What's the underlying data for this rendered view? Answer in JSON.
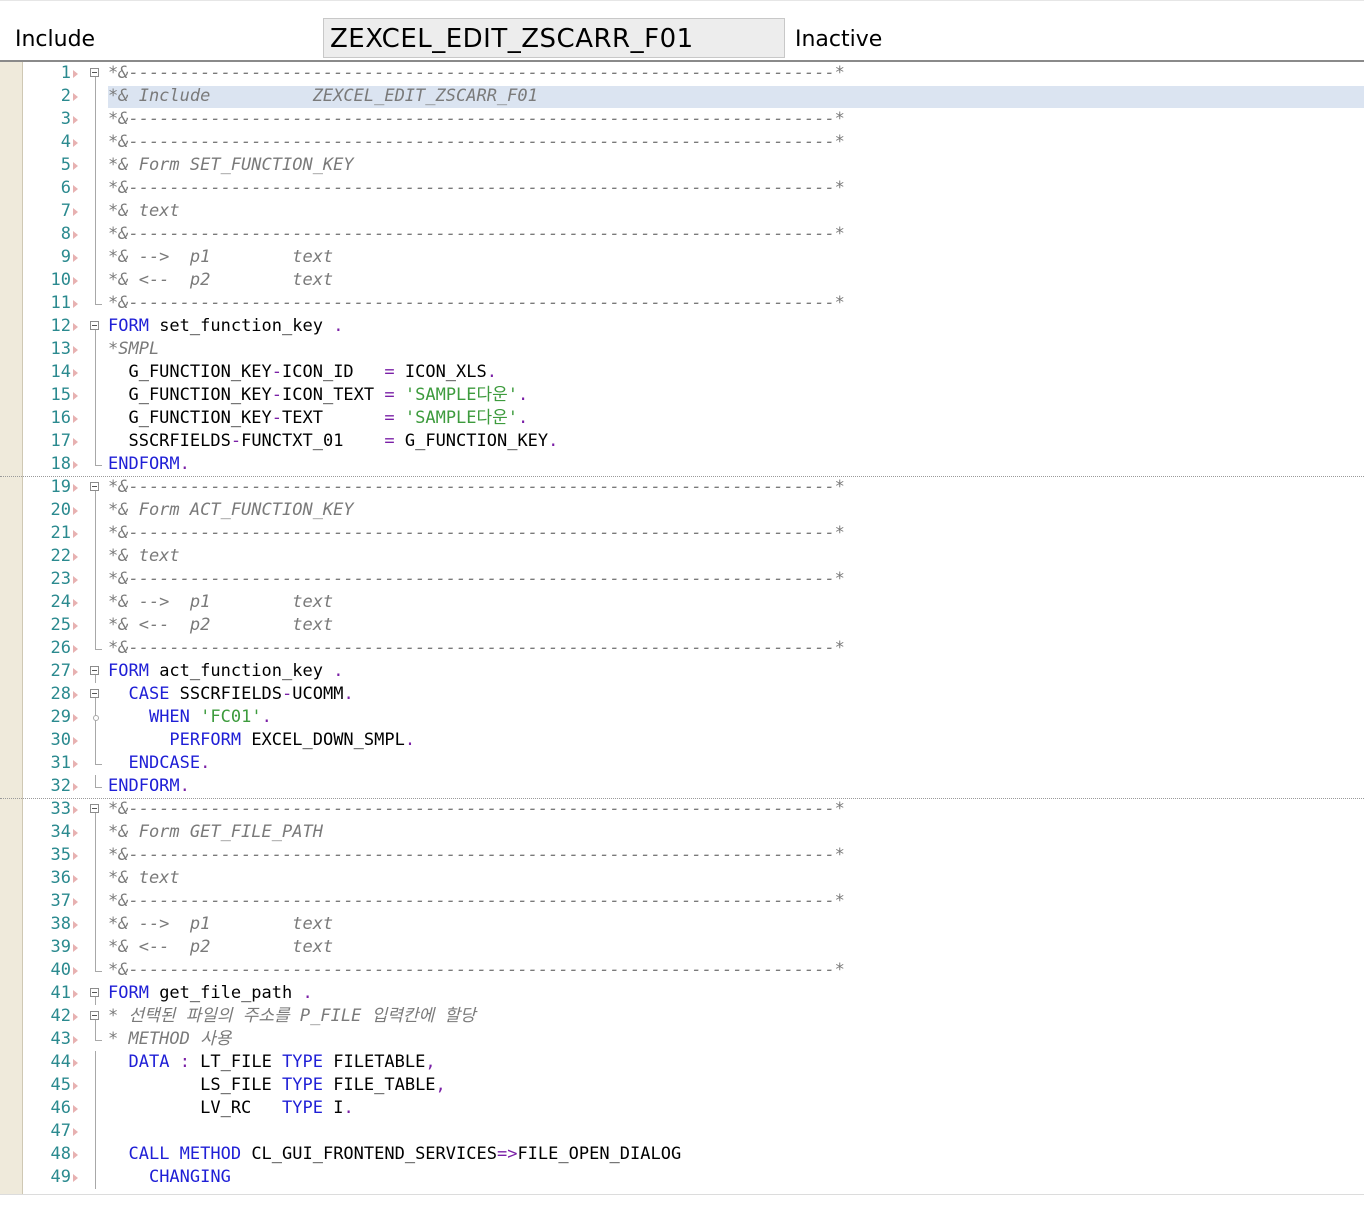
{
  "header": {
    "label": "Include",
    "include_name": "ZEXCEL_EDIT_ZSCARR_F01",
    "status": "Inactive"
  },
  "colors": {
    "keyword": "#1f1fd6",
    "string": "#3d9b3d",
    "comment": "#7a7a7a",
    "line_number": "#2b8a8f",
    "highlight": "#dbe4f1"
  },
  "editor": {
    "lines": [
      {
        "n": "1",
        "fold": "box",
        "type": "comment",
        "segments": [
          {
            "t": "*&---------------------------------------------------------------------*"
          }
        ]
      },
      {
        "n": "2",
        "fold": "line",
        "type": "comment",
        "highlight": true,
        "segments": [
          {
            "t": "*& Include          ZEXCEL_EDIT_ZSCARR_F01"
          }
        ]
      },
      {
        "n": "3",
        "fold": "line",
        "type": "comment",
        "segments": [
          {
            "t": "*&---------------------------------------------------------------------*"
          }
        ]
      },
      {
        "n": "4",
        "fold": "line",
        "type": "comment",
        "segments": [
          {
            "t": "*&---------------------------------------------------------------------*"
          }
        ]
      },
      {
        "n": "5",
        "fold": "line",
        "type": "comment",
        "segments": [
          {
            "t": "*& Form SET_FUNCTION_KEY"
          }
        ]
      },
      {
        "n": "6",
        "fold": "line",
        "type": "comment",
        "segments": [
          {
            "t": "*&---------------------------------------------------------------------*"
          }
        ]
      },
      {
        "n": "7",
        "fold": "line",
        "type": "comment",
        "segments": [
          {
            "t": "*& text"
          }
        ]
      },
      {
        "n": "8",
        "fold": "line",
        "type": "comment",
        "segments": [
          {
            "t": "*&---------------------------------------------------------------------*"
          }
        ]
      },
      {
        "n": "9",
        "fold": "line",
        "type": "comment",
        "segments": [
          {
            "t": "*& -->  p1        text"
          }
        ]
      },
      {
        "n": "10",
        "fold": "line",
        "type": "comment",
        "segments": [
          {
            "t": "*& <--  p2        text"
          }
        ]
      },
      {
        "n": "11",
        "fold": "end",
        "type": "comment",
        "segments": [
          {
            "t": "*&---------------------------------------------------------------------*"
          }
        ]
      },
      {
        "n": "12",
        "fold": "box",
        "type": "code",
        "segments": [
          {
            "t": "FORM",
            "c": "k"
          },
          {
            "t": " set_function_key "
          },
          {
            "t": ".",
            "c": "p"
          }
        ]
      },
      {
        "n": "13",
        "fold": "line",
        "type": "comment",
        "segments": [
          {
            "t": "*SMPL"
          }
        ]
      },
      {
        "n": "14",
        "fold": "line",
        "type": "code",
        "segments": [
          {
            "t": "  G_FUNCTION_KEY"
          },
          {
            "t": "-",
            "c": "p"
          },
          {
            "t": "ICON_ID   "
          },
          {
            "t": "=",
            "c": "p"
          },
          {
            "t": " ICON_XLS"
          },
          {
            "t": ".",
            "c": "p"
          }
        ]
      },
      {
        "n": "15",
        "fold": "line",
        "type": "code",
        "segments": [
          {
            "t": "  G_FUNCTION_KEY"
          },
          {
            "t": "-",
            "c": "p"
          },
          {
            "t": "ICON_TEXT "
          },
          {
            "t": "=",
            "c": "p"
          },
          {
            "t": " "
          },
          {
            "t": "'SAMPLE다운'",
            "c": "s"
          },
          {
            "t": ".",
            "c": "p"
          }
        ]
      },
      {
        "n": "16",
        "fold": "line",
        "type": "code",
        "segments": [
          {
            "t": "  G_FUNCTION_KEY"
          },
          {
            "t": "-",
            "c": "p"
          },
          {
            "t": "TEXT      "
          },
          {
            "t": "=",
            "c": "p"
          },
          {
            "t": " "
          },
          {
            "t": "'SAMPLE다운'",
            "c": "s"
          },
          {
            "t": ".",
            "c": "p"
          }
        ]
      },
      {
        "n": "17",
        "fold": "line",
        "type": "code",
        "segments": [
          {
            "t": "  SSCRFIELDS"
          },
          {
            "t": "-",
            "c": "p"
          },
          {
            "t": "FUNCTXT_01    "
          },
          {
            "t": "=",
            "c": "p"
          },
          {
            "t": " G_FUNCTION_KEY"
          },
          {
            "t": ".",
            "c": "p"
          }
        ]
      },
      {
        "n": "18",
        "fold": "end",
        "type": "code",
        "sep": true,
        "segments": [
          {
            "t": "ENDFORM",
            "c": "k"
          },
          {
            "t": ".",
            "c": "p"
          }
        ]
      },
      {
        "n": "19",
        "fold": "box",
        "type": "comment",
        "segments": [
          {
            "t": "*&---------------------------------------------------------------------*"
          }
        ]
      },
      {
        "n": "20",
        "fold": "line",
        "type": "comment",
        "segments": [
          {
            "t": "*& Form ACT_FUNCTION_KEY"
          }
        ]
      },
      {
        "n": "21",
        "fold": "line",
        "type": "comment",
        "segments": [
          {
            "t": "*&---------------------------------------------------------------------*"
          }
        ]
      },
      {
        "n": "22",
        "fold": "line",
        "type": "comment",
        "segments": [
          {
            "t": "*& text"
          }
        ]
      },
      {
        "n": "23",
        "fold": "line",
        "type": "comment",
        "segments": [
          {
            "t": "*&---------------------------------------------------------------------*"
          }
        ]
      },
      {
        "n": "24",
        "fold": "line",
        "type": "comment",
        "segments": [
          {
            "t": "*& -->  p1        text"
          }
        ]
      },
      {
        "n": "25",
        "fold": "line",
        "type": "comment",
        "segments": [
          {
            "t": "*& <--  p2        text"
          }
        ]
      },
      {
        "n": "26",
        "fold": "end",
        "type": "comment",
        "segments": [
          {
            "t": "*&---------------------------------------------------------------------*"
          }
        ]
      },
      {
        "n": "27",
        "fold": "box",
        "type": "code",
        "segments": [
          {
            "t": "FORM",
            "c": "k"
          },
          {
            "t": " act_function_key "
          },
          {
            "t": ".",
            "c": "p"
          }
        ]
      },
      {
        "n": "28",
        "fold": "box",
        "type": "code",
        "segments": [
          {
            "t": "  "
          },
          {
            "t": "CASE",
            "c": "k"
          },
          {
            "t": " SSCRFIELDS"
          },
          {
            "t": "-",
            "c": "p"
          },
          {
            "t": "UCOMM"
          },
          {
            "t": ".",
            "c": "p"
          }
        ]
      },
      {
        "n": "29",
        "fold": "dot",
        "type": "code",
        "segments": [
          {
            "t": "    "
          },
          {
            "t": "WHEN",
            "c": "k"
          },
          {
            "t": " "
          },
          {
            "t": "'FC01'",
            "c": "s"
          },
          {
            "t": ".",
            "c": "p"
          }
        ]
      },
      {
        "n": "30",
        "fold": "line",
        "type": "code",
        "segments": [
          {
            "t": "      "
          },
          {
            "t": "PERFORM",
            "c": "k"
          },
          {
            "t": " EXCEL_DOWN_SMPL"
          },
          {
            "t": ".",
            "c": "p"
          }
        ]
      },
      {
        "n": "31",
        "fold": "end",
        "type": "code",
        "segments": [
          {
            "t": "  "
          },
          {
            "t": "ENDCASE",
            "c": "k"
          },
          {
            "t": ".",
            "c": "p"
          }
        ]
      },
      {
        "n": "32",
        "fold": "end",
        "type": "code",
        "sep": true,
        "segments": [
          {
            "t": "ENDFORM",
            "c": "k"
          },
          {
            "t": ".",
            "c": "p"
          }
        ]
      },
      {
        "n": "33",
        "fold": "box",
        "type": "comment",
        "segments": [
          {
            "t": "*&---------------------------------------------------------------------*"
          }
        ]
      },
      {
        "n": "34",
        "fold": "line",
        "type": "comment",
        "segments": [
          {
            "t": "*& Form GET_FILE_PATH"
          }
        ]
      },
      {
        "n": "35",
        "fold": "line",
        "type": "comment",
        "segments": [
          {
            "t": "*&---------------------------------------------------------------------*"
          }
        ]
      },
      {
        "n": "36",
        "fold": "line",
        "type": "comment",
        "segments": [
          {
            "t": "*& text"
          }
        ]
      },
      {
        "n": "37",
        "fold": "line",
        "type": "comment",
        "segments": [
          {
            "t": "*&---------------------------------------------------------------------*"
          }
        ]
      },
      {
        "n": "38",
        "fold": "line",
        "type": "comment",
        "segments": [
          {
            "t": "*& -->  p1        text"
          }
        ]
      },
      {
        "n": "39",
        "fold": "line",
        "type": "comment",
        "segments": [
          {
            "t": "*& <--  p2        text"
          }
        ]
      },
      {
        "n": "40",
        "fold": "end",
        "type": "comment",
        "segments": [
          {
            "t": "*&---------------------------------------------------------------------*"
          }
        ]
      },
      {
        "n": "41",
        "fold": "box",
        "type": "code",
        "segments": [
          {
            "t": "FORM",
            "c": "k"
          },
          {
            "t": " get_file_path "
          },
          {
            "t": ".",
            "c": "p"
          }
        ]
      },
      {
        "n": "42",
        "fold": "box",
        "type": "comment",
        "segments": [
          {
            "t": "* 선택된 파일의 주소를 P_FILE 입력칸에 할당"
          }
        ]
      },
      {
        "n": "43",
        "fold": "end",
        "type": "comment",
        "segments": [
          {
            "t": "* METHOD 사용"
          }
        ]
      },
      {
        "n": "44",
        "fold": "line",
        "type": "code",
        "segments": [
          {
            "t": "  "
          },
          {
            "t": "DATA",
            "c": "k"
          },
          {
            "t": " "
          },
          {
            "t": ":",
            "c": "p"
          },
          {
            "t": " LT_FILE "
          },
          {
            "t": "TYPE",
            "c": "k"
          },
          {
            "t": " FILETABLE"
          },
          {
            "t": ",",
            "c": "p"
          }
        ]
      },
      {
        "n": "45",
        "fold": "line",
        "type": "code",
        "segments": [
          {
            "t": "         LS_FILE "
          },
          {
            "t": "TYPE",
            "c": "k"
          },
          {
            "t": " FILE_TABLE"
          },
          {
            "t": ",",
            "c": "p"
          }
        ]
      },
      {
        "n": "46",
        "fold": "line",
        "type": "code",
        "segments": [
          {
            "t": "         LV_RC   "
          },
          {
            "t": "TYPE",
            "c": "k"
          },
          {
            "t": " I"
          },
          {
            "t": ".",
            "c": "p"
          }
        ]
      },
      {
        "n": "47",
        "fold": "line",
        "type": "code",
        "segments": [
          {
            "t": ""
          }
        ]
      },
      {
        "n": "48",
        "fold": "line",
        "type": "code",
        "segments": [
          {
            "t": "  "
          },
          {
            "t": "CALL METHOD",
            "c": "k"
          },
          {
            "t": " CL_GUI_FRONTEND_SERVICES"
          },
          {
            "t": "=>",
            "c": "p"
          },
          {
            "t": "FILE_OPEN_DIALOG"
          }
        ]
      },
      {
        "n": "49",
        "fold": "line",
        "type": "code",
        "segments": [
          {
            "t": "    "
          },
          {
            "t": "CHANGING",
            "c": "k"
          }
        ]
      }
    ]
  }
}
